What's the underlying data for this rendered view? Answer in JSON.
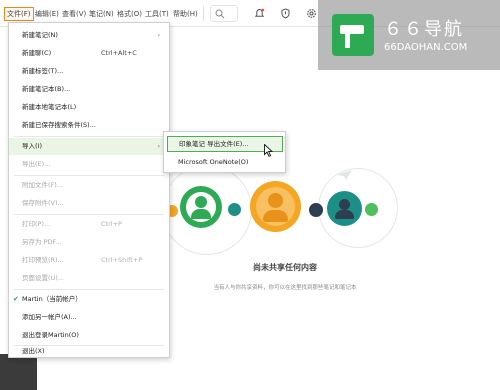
{
  "menubar": {
    "items": [
      {
        "label": "文件(F)",
        "active": true
      },
      {
        "label": "编辑(E)"
      },
      {
        "label": "查看(V)"
      },
      {
        "label": "笔记(N)"
      },
      {
        "label": "格式(O)"
      },
      {
        "label": "工具(T)"
      },
      {
        "label": "帮助(H)"
      }
    ],
    "icons": [
      "bell-icon",
      "shield-icon",
      "gear-icon"
    ]
  },
  "file_menu": {
    "items": [
      {
        "label": "新建笔记(N)",
        "arrow": "›"
      },
      {
        "label": "新建聊(C)",
        "shortcut": "Ctrl+Alt+C"
      },
      {
        "label": "新建标签(T)..."
      },
      {
        "label": "新建笔记本(B)..."
      },
      {
        "label": "新建本地笔记本(L)"
      },
      {
        "label": "新建已保存搜索条件(S)..."
      },
      {
        "label": "导入(I)",
        "arrow": "›"
      },
      {
        "label": "导出(E)..."
      },
      {
        "label": "附加文件(F)..."
      },
      {
        "label": "保存附件(V)..."
      },
      {
        "label": "打印(P)...",
        "shortcut": "Ctrl+P"
      },
      {
        "label": "另存为 PDF..."
      },
      {
        "label": "打印预览(R)...",
        "shortcut": "Ctrl+Shift+P"
      },
      {
        "label": "页面设置(U)..."
      },
      {
        "label": "Martin（当前帐户）",
        "check": "✔"
      },
      {
        "label": "添加另一帐户(A)..."
      },
      {
        "label": "退出登录Martin(O)"
      },
      {
        "label": "退出(X)"
      }
    ]
  },
  "submenu": {
    "items": [
      {
        "label": "印象笔记 导出文件(E)..."
      },
      {
        "label": "Microsoft OneNote(O)"
      }
    ]
  },
  "empty_state": {
    "title": "尚未共享任何内容",
    "description": "当有人与你共享资料，你可以在这里找到那些笔记和笔记本"
  },
  "watermark": {
    "title": "６６导航",
    "subtitle": "66DAOHAN.COM"
  },
  "colors": {
    "green": "#2eaa55",
    "orange": "#f5a623",
    "teal": "#1e8f86",
    "dark_navy": "#2c3e50",
    "menu_highlight": "#eaf5e6"
  }
}
